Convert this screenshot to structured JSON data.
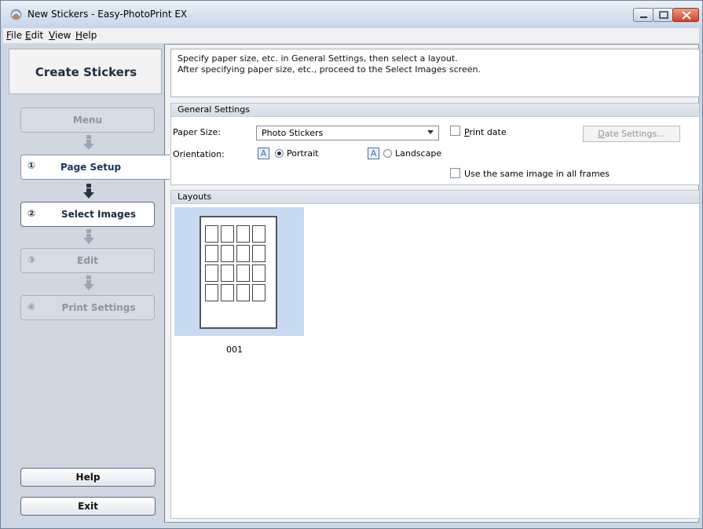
{
  "window": {
    "title": "New Stickers - Easy-PhotoPrint EX"
  },
  "menu": {
    "items": [
      {
        "label": "File",
        "underline": "F",
        "rest": "ile"
      },
      {
        "label": "Edit",
        "underline": "E",
        "rest": "dit"
      },
      {
        "label": "View",
        "underline": "V",
        "rest": "iew"
      },
      {
        "label": "Help",
        "underline": "H",
        "rest": "elp"
      }
    ]
  },
  "sidebar": {
    "title": "Create Stickers",
    "menu_label": "Menu",
    "steps": [
      {
        "num": "①",
        "label": "Page Setup"
      },
      {
        "num": "②",
        "label": "Select Images"
      },
      {
        "num": "③",
        "label": "Edit"
      },
      {
        "num": "④",
        "label": "Print Settings"
      }
    ],
    "help_label": "Help",
    "exit_label": "Exit"
  },
  "info": {
    "line1": "Specify paper size, etc. in General Settings, then select a layout.",
    "line2": "After specifying paper size, etc., proceed to the Select Images screen."
  },
  "general_settings": {
    "heading": "General Settings",
    "paper_size_label": "Paper Size:",
    "paper_size_value": "Photo Stickers",
    "print_date_label_ul": "P",
    "print_date_label_rest": "rint date",
    "date_settings_ul": "D",
    "date_settings_rest": "ate Settings...",
    "orientation_label": "Orientation:",
    "portrait_label": "Portrait",
    "landscape_label": "Landscape",
    "same_image_label": "Use the same image in all frames",
    "orientation_selected": "Portrait"
  },
  "layouts": {
    "heading": "Layouts",
    "items": [
      {
        "label": "001",
        "selected": true
      }
    ]
  },
  "colors": {
    "sidebar_bg": "#d0d7e1",
    "selection_bg": "#c7daf1",
    "title_text": "#1e2d40"
  }
}
